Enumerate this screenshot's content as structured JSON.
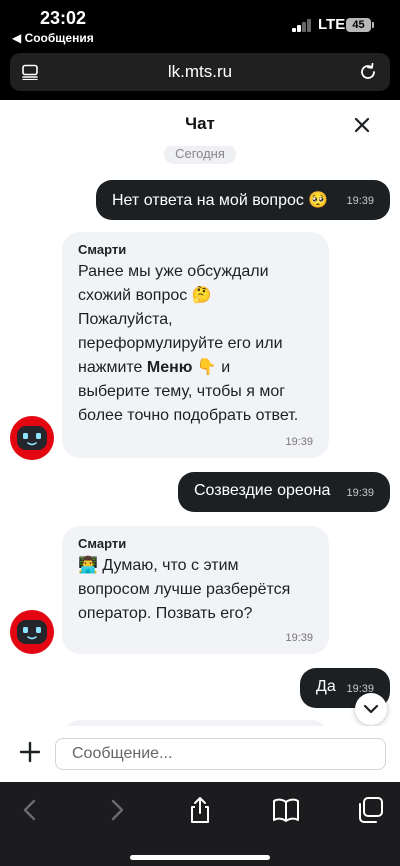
{
  "status_bar": {
    "time": "23:02",
    "back_app": "◀ Сообщения",
    "network": "LTE",
    "battery": "45"
  },
  "browser": {
    "url": "lk.mts.ru"
  },
  "chat": {
    "title": "Чат",
    "date_label": "Сегодня",
    "messages": [
      {
        "direction": "out",
        "text": "Нет ответа на мой вопрос 🥺",
        "time": "19:39"
      },
      {
        "direction": "in",
        "sender": "Смарти",
        "lines": [
          "Ранее мы уже обсуждали",
          "схожий вопрос 🤔",
          "Пожалуйста,",
          "переформулируйте его или",
          "нажмите",
          "Меню",
          "👇 и",
          "выберите тему, чтобы я мог",
          "более точно подобрать ответ."
        ],
        "time": "19:39"
      },
      {
        "direction": "out",
        "text": "Созвездие ореона",
        "time": "19:39"
      },
      {
        "direction": "in",
        "sender": "Смарти",
        "lines": [
          "👨‍💻 Думаю, что с этим",
          "вопросом лучше разберётся",
          "оператор. Позвать его?"
        ],
        "time": "19:39"
      },
      {
        "direction": "out",
        "text": "Да",
        "time": "19:39"
      }
    ],
    "input_placeholder": "Сообщение..."
  },
  "colors": {
    "outgoing_bubble": "#1d2023",
    "incoming_bubble": "#f2f3f7",
    "bot_avatar": "#e30611"
  },
  "icons": {
    "address_menu": "page-menu-icon",
    "reload": "reload-icon",
    "close": "close-icon",
    "scroll": "chevron-down-icon",
    "attach": "plus-icon",
    "toolbar": [
      "back-arrow-icon",
      "forward-arrow-icon",
      "share-icon",
      "bookmarks-icon",
      "tabs-icon"
    ]
  }
}
